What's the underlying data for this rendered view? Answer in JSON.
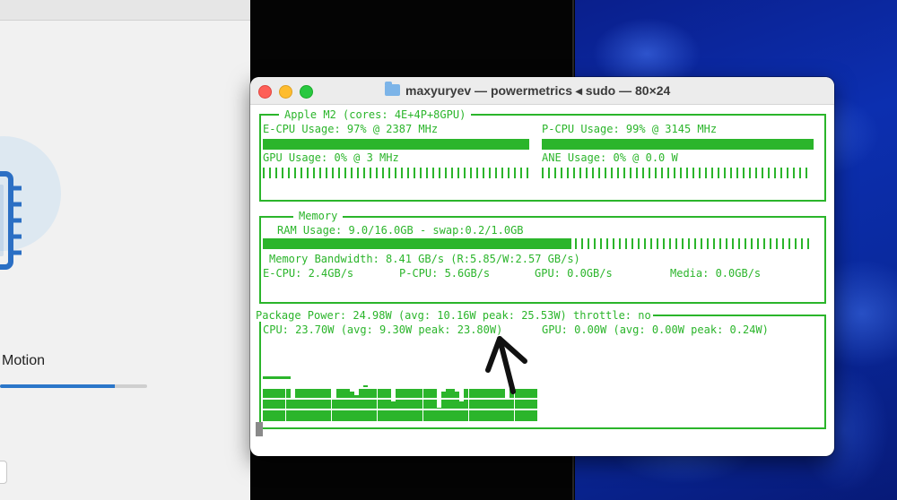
{
  "left_app": {
    "label": "Motion",
    "progress_fraction": 0.78,
    "icon": "cpu-chip-icon"
  },
  "terminal": {
    "title": "maxyuryev — powermetrics ◂ sudo — 80×24",
    "folder_icon": "folder-icon",
    "cpu_section": {
      "legend": "Apple M2 (cores: 4E+4P+8GPU)",
      "ecpu": "E-CPU Usage: 97% @ 2387 MHz",
      "pcpu": "P-CPU Usage: 99% @ 3145 MHz",
      "gpu": "GPU Usage: 0% @ 3 MHz",
      "ane": "ANE Usage: 0% @ 0.0 W",
      "ecpu_percent": 97,
      "pcpu_percent": 99,
      "gpu_percent": 0,
      "ane_percent": 0
    },
    "memory_section": {
      "legend": "Memory",
      "ram": "RAM Usage: 9.0/16.0GB - swap:0.2/1.0GB",
      "ram_fraction": 0.5625,
      "bandwidth": "Memory Bandwidth: 8.41 GB/s (R:5.85/W:2.57 GB/s)",
      "ecpu_bw": "E-CPU: 2.4GB/s",
      "pcpu_bw": "P-CPU: 5.6GB/s",
      "gpu_bw": "GPU: 0.0GB/s",
      "media_bw": "Media: 0.0GB/s"
    },
    "power_section": {
      "package": "Package Power: 24.98W (avg: 10.16W peak: 25.53W) throttle: no",
      "cpu": "CPU: 23.70W (avg: 9.30W peak: 23.80W)",
      "gpu": "GPU: 0.00W (avg: 0.00W peak: 0.24W)",
      "cpu_power_history_watts": [
        20,
        20,
        20,
        20,
        20,
        20,
        14,
        20,
        20,
        20,
        20,
        20,
        20,
        20,
        20,
        14,
        20,
        20,
        20,
        18,
        16,
        20,
        22,
        20,
        20,
        20,
        20,
        20,
        12,
        20,
        20,
        20,
        20,
        20,
        20,
        20,
        20,
        20,
        8,
        18,
        20,
        20,
        18,
        12,
        20,
        20,
        20,
        20,
        20,
        20,
        20,
        20,
        20,
        14,
        20,
        20,
        20,
        20,
        20,
        20
      ]
    },
    "annotation": "hand-drawn-arrow-icon"
  }
}
